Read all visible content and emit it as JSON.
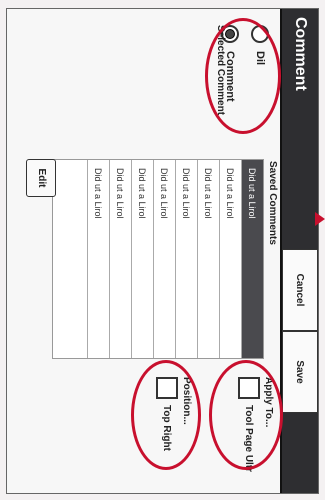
{
  "dialog": {
    "title": "Comment",
    "cancel_label": "Cancel",
    "save_label": "Save"
  },
  "mode": {
    "options": [
      {
        "label": "Dil",
        "checked": false
      },
      {
        "label": "Comment",
        "checked": true
      }
    ]
  },
  "saved_comments": {
    "label": "Saved Comments",
    "items": [
      "Did ut a Lirol",
      "Did ut a Lirol",
      "Did ut a Lirol",
      "Did ut a Lirol",
      "Did ut a Lirol",
      "Did ut a Lirol",
      "Did ut a Lirol",
      "Did ut a Lirol"
    ],
    "selected_index": 0
  },
  "selected_comment": {
    "label": "Selected Comment",
    "edit_label": "Edit"
  },
  "apply_to": {
    "label": "Apply To...",
    "option_label": "Tool Page Ultr"
  },
  "position": {
    "label": "Position...",
    "option_label": "Top Right"
  },
  "annotation_color": "#c8102e"
}
